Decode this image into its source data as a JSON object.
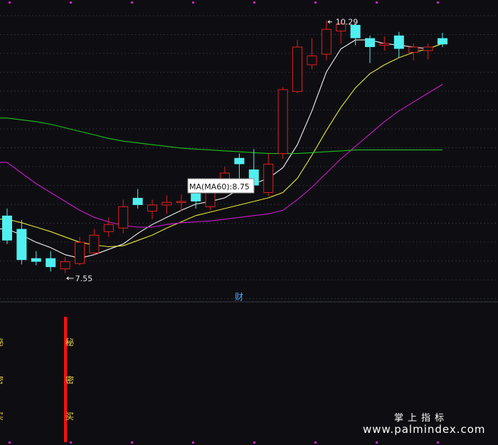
{
  "chart_data": {
    "type": "candlestick",
    "price_range": [
      7.2,
      10.45
    ],
    "grid": true,
    "candles": [
      {
        "o": 8.1,
        "c": 7.82,
        "h": 8.18,
        "l": 7.78
      },
      {
        "o": 7.95,
        "c": 7.6,
        "h": 8.05,
        "l": 7.55
      },
      {
        "o": 7.62,
        "c": 7.58,
        "h": 7.7,
        "l": 7.54
      },
      {
        "o": 7.62,
        "c": 7.52,
        "h": 7.7,
        "l": 7.47
      },
      {
        "o": 7.5,
        "c": 7.58,
        "h": 7.63,
        "l": 7.45
      },
      {
        "o": 7.56,
        "c": 7.8,
        "h": 7.86,
        "l": 7.54
      },
      {
        "o": 7.68,
        "c": 7.88,
        "h": 7.95,
        "l": 7.66
      },
      {
        "o": 7.92,
        "c": 8.0,
        "h": 8.08,
        "l": 7.86
      },
      {
        "o": 7.96,
        "c": 8.2,
        "h": 8.28,
        "l": 7.9
      },
      {
        "o": 8.3,
        "c": 8.22,
        "h": 8.4,
        "l": 8.18
      },
      {
        "o": 8.15,
        "c": 8.22,
        "h": 8.28,
        "l": 8.06
      },
      {
        "o": 8.22,
        "c": 8.25,
        "h": 8.33,
        "l": 8.12
      },
      {
        "o": 8.25,
        "c": 8.26,
        "h": 8.34,
        "l": 8.15
      },
      {
        "o": 8.35,
        "c": 8.26,
        "h": 8.44,
        "l": 8.18
      },
      {
        "o": 8.2,
        "c": 8.36,
        "h": 8.4,
        "l": 8.16
      },
      {
        "o": 8.4,
        "c": 8.58,
        "h": 8.65,
        "l": 8.36
      },
      {
        "o": 8.75,
        "c": 8.68,
        "h": 8.8,
        "l": 8.52
      },
      {
        "o": 8.62,
        "c": 8.44,
        "h": 8.85,
        "l": 8.4
      },
      {
        "o": 8.36,
        "c": 8.68,
        "h": 8.8,
        "l": 8.32
      },
      {
        "o": 8.8,
        "c": 9.52,
        "h": 9.55,
        "l": 8.74
      },
      {
        "o": 9.5,
        "c": 10.0,
        "h": 10.08,
        "l": 9.48
      },
      {
        "o": 9.8,
        "c": 9.9,
        "h": 10.1,
        "l": 9.75
      },
      {
        "o": 9.92,
        "c": 10.2,
        "h": 10.3,
        "l": 9.85
      },
      {
        "o": 10.18,
        "c": 10.26,
        "h": 10.29,
        "l": 10.04
      },
      {
        "o": 10.25,
        "c": 10.1,
        "h": 10.27,
        "l": 10.02
      },
      {
        "o": 10.1,
        "c": 10.0,
        "h": 10.13,
        "l": 9.82
      },
      {
        "o": 10.02,
        "c": 10.04,
        "h": 10.12,
        "l": 9.96
      },
      {
        "o": 10.13,
        "c": 9.98,
        "h": 10.17,
        "l": 9.88
      },
      {
        "o": 9.94,
        "c": 10.0,
        "h": 10.04,
        "l": 9.85
      },
      {
        "o": 9.96,
        "c": 10.0,
        "h": 10.04,
        "l": 9.86
      },
      {
        "o": 10.1,
        "c": 10.03,
        "h": 10.16,
        "l": 10.0
      }
    ],
    "ma_series": [
      {
        "color": "#f2f2f2",
        "values": [
          7.95,
          7.88,
          7.8,
          7.74,
          7.66,
          7.62,
          7.66,
          7.72,
          7.78,
          7.9,
          8.0,
          8.08,
          8.16,
          8.23,
          8.26,
          8.3,
          8.4,
          8.46,
          8.52,
          8.64,
          8.9,
          9.28,
          9.72,
          9.98,
          10.08,
          10.08,
          10.04,
          10.02,
          10.0,
          9.98,
          10.04
        ]
      },
      {
        "color": "#e8e838",
        "values": [
          8.06,
          8.02,
          7.97,
          7.92,
          7.86,
          7.8,
          7.77,
          7.75,
          7.76,
          7.82,
          7.88,
          7.96,
          8.03,
          8.1,
          8.14,
          8.18,
          8.22,
          8.26,
          8.3,
          8.36,
          8.52,
          8.78,
          9.06,
          9.32,
          9.54,
          9.7,
          9.8,
          9.88,
          9.94,
          9.98,
          10.04
        ]
      },
      {
        "color": "#d018d0",
        "values": [
          8.7,
          8.58,
          8.46,
          8.36,
          8.26,
          8.16,
          8.08,
          8.03,
          7.99,
          7.97,
          7.97,
          8.0,
          8.02,
          8.03,
          8.04,
          8.06,
          8.08,
          8.1,
          8.12,
          8.16,
          8.28,
          8.42,
          8.58,
          8.74,
          8.88,
          9.02,
          9.16,
          9.28,
          9.38,
          9.48,
          9.58
        ]
      },
      {
        "color": "#20c020",
        "values": [
          9.2,
          9.18,
          9.16,
          9.13,
          9.09,
          9.05,
          9.01,
          8.97,
          8.94,
          8.92,
          8.9,
          8.88,
          8.86,
          8.85,
          8.84,
          8.83,
          8.82,
          8.81,
          8.8,
          8.8,
          8.8,
          8.81,
          8.82,
          8.83,
          8.84,
          8.84,
          8.84,
          8.84,
          8.84,
          8.84,
          8.84
        ]
      }
    ],
    "annotations": {
      "high": "10.29",
      "low": "7.55",
      "ma_tooltip": "MA(MA60):8.75",
      "marker": "财"
    },
    "signal_labels": [
      "秘",
      "密",
      "买"
    ],
    "signal_labels_left": [
      "秘",
      "密",
      "买"
    ]
  },
  "watermark": {
    "cn": "掌上指标",
    "url": "www.palmindex.com"
  },
  "colors": {
    "background": "#0e0e12",
    "up": "#e02020",
    "down": "#50f0f0",
    "grid": "#2a2a36",
    "signal_bar": "#ff1010",
    "separator": "#3a3a4a",
    "dots": "#d020d0"
  }
}
